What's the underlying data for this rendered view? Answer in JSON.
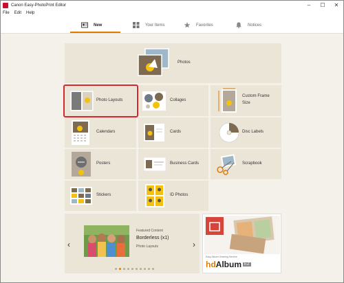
{
  "window": {
    "title": "Canon Easy-PhotoPrint Editor"
  },
  "window_controls": {
    "minimize": "–",
    "maximize": "☐",
    "close": "✕"
  },
  "menu": [
    "File",
    "Edit",
    "Help"
  ],
  "tabs": [
    {
      "label": "New",
      "icon": "new-icon",
      "active": true
    },
    {
      "label": "Your Items",
      "icon": "grid-icon"
    },
    {
      "label": "Favorites",
      "icon": "star-icon"
    },
    {
      "label": "Notices",
      "icon": "bell-icon"
    }
  ],
  "tiles": {
    "photos": "Photos",
    "photo_layouts": "Photo Layouts",
    "collages": "Collages",
    "custom_frame_size": [
      "Custom Frame",
      "Size"
    ],
    "calendars": "Calendars",
    "cards": "Cards",
    "disc_labels": "Disc Labels",
    "posters": "Posters",
    "business_cards": "Business Cards",
    "scrapbook": "Scrapbook",
    "stickers": "Stickers",
    "id_photos": "ID Photos"
  },
  "featured": {
    "caption": "Featured Content",
    "title": "Borderless (x1)",
    "subtitle": "Photo Layouts",
    "prev": "‹",
    "next": "›",
    "dot_count": 10,
    "active_dot": 1
  },
  "album_ad": {
    "service_text": "Easy Album Ordering Service",
    "brand_hd": "hd",
    "brand_album": "Album",
    "brand_ez": "EZ"
  },
  "colors": {
    "accent": "#e07b00",
    "selection": "#d9262c",
    "tile_bg": "#ebe5d8",
    "page_bg": "#f4f1ea"
  }
}
